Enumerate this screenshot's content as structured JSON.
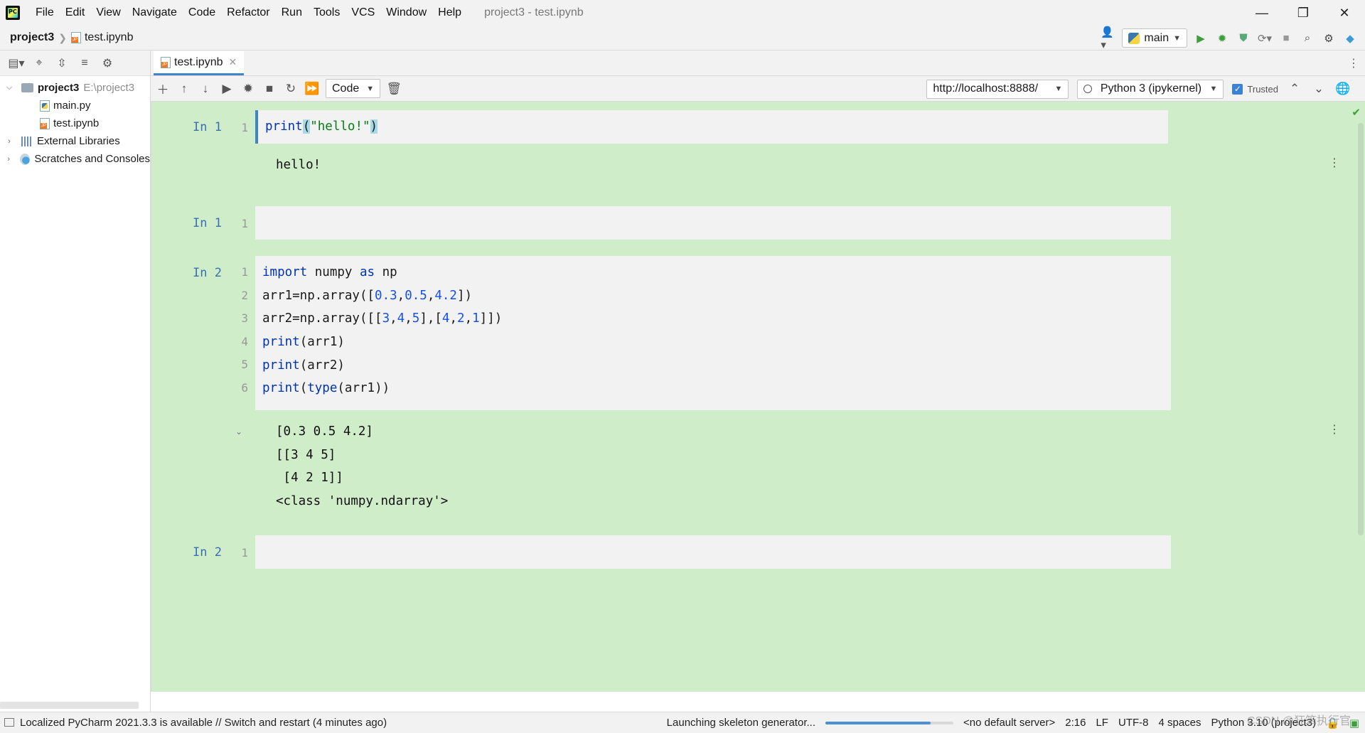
{
  "titlebar": {
    "menu": [
      "File",
      "Edit",
      "View",
      "Navigate",
      "Code",
      "Refactor",
      "Run",
      "Tools",
      "VCS",
      "Window",
      "Help"
    ],
    "window_title": "project3 - test.ipynb"
  },
  "navbar": {
    "project": "project3",
    "file": "test.ipynb",
    "run_config": "main"
  },
  "sidebar": {
    "tree": [
      {
        "label": "project3",
        "path": "E:\\project3"
      },
      {
        "label": "main.py"
      },
      {
        "label": "test.ipynb"
      },
      {
        "label": "External Libraries"
      },
      {
        "label": "Scratches and Consoles"
      }
    ]
  },
  "editor": {
    "tab_label": "test.ipynb",
    "cell_type": "Code",
    "server_url": "http://localhost:8888/",
    "kernel": "Python 3 (ipykernel)",
    "trusted_label": "Trusted"
  },
  "notebook": {
    "cells": [
      {
        "prompt": "In 1",
        "output": [
          "hello!"
        ]
      },
      {
        "prompt": "In 1"
      },
      {
        "prompt": "In 2",
        "output": [
          "[0.3 0.5 4.2]",
          "[[3 4 5]",
          " [4 2 1]]",
          "<class 'numpy.ndarray'>"
        ]
      },
      {
        "prompt": "In 2"
      }
    ]
  },
  "statusbar": {
    "message": "Localized PyCharm 2021.3.3 is available // Switch and restart (4 minutes ago)",
    "task": "Launching skeleton generator...",
    "task_progress": 0.82,
    "server": "<no default server>",
    "position": "2:16",
    "line_sep": "LF",
    "encoding": "UTF-8",
    "indent": "4 spaces",
    "interpreter": "Python 3.10 (project3)",
    "watermark": "CSDN @狂笨执行官"
  }
}
